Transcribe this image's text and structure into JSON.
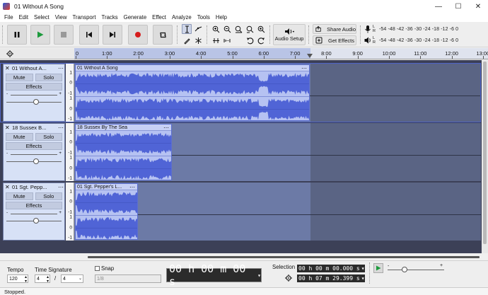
{
  "window": {
    "title": "01 Without A Song"
  },
  "menu": [
    "File",
    "Edit",
    "Select",
    "View",
    "Transport",
    "Tracks",
    "Generate",
    "Effect",
    "Analyze",
    "Tools",
    "Help"
  ],
  "toolbar": {
    "share_audio_label": "Share Audio",
    "get_effects_label": "Get Effects",
    "audio_setup_label": "Audio Setup",
    "meter_ticks": "-54 -48 -42 -36 -30 -24 -18 -12 -6 0",
    "meter_ticks_play": "-54 -48 -42 -36 -30 -24 -18 -12 -6 0",
    "meter_lr_rec": "L\nR",
    "meter_l": "L",
    "meter_r": "R"
  },
  "ruler": {
    "ticks": [
      "0",
      "1:00",
      "2:00",
      "3:00",
      "4:00",
      "5:00",
      "6:00",
      "7:00",
      "8:00",
      "9:00",
      "10:00",
      "11:00",
      "12:00",
      "13:00"
    ]
  },
  "tracks": [
    {
      "name": "01 Without A...",
      "clip_name": "01 Without A Song",
      "mute": "Mute",
      "solo": "Solo",
      "effects": "Effects"
    },
    {
      "name": "18 Sussex B...",
      "clip_name": "18 Sussex By The Sea",
      "mute": "Mute",
      "solo": "Solo",
      "effects": "Effects"
    },
    {
      "name": "01 Sgt. Pepp...",
      "clip_name": "01 Sgt. Pepper's L...",
      "mute": "Mute",
      "solo": "Solo",
      "effects": "Effects"
    }
  ],
  "scale_labels": {
    "one": "1",
    "zero": "0",
    "minus_one": "-1"
  },
  "gain": {
    "minus": "-",
    "plus": "+"
  },
  "bottom": {
    "tempo_label": "Tempo",
    "tempo_value": "120",
    "time_sig_label": "Time Signature",
    "time_sig_num": "4",
    "time_sig_sep": "/",
    "time_sig_den": "4",
    "snap_label": "Snap",
    "snap_value": "1/8",
    "time_display": "00 h 00 m 00 s",
    "selection_label": "Selection",
    "selection_start": "00 h 00 m 00.000 s",
    "selection_end": "00 h 07 m 29.399 s"
  },
  "status": {
    "text": "Stopped."
  }
}
